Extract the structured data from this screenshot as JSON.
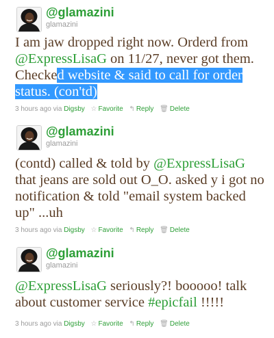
{
  "tweets": [
    {
      "screen_name": "@glamazini",
      "real_name": "glamazini",
      "text_parts": [
        {
          "t": "I am jaw dropped right now. Orderd from ",
          "type": "text"
        },
        {
          "t": "@ExpressLisaG",
          "type": "mention"
        },
        {
          "t": " on 11/27, never got them. Checke",
          "type": "text"
        },
        {
          "t": "d website & said to call for order status. (con'td)",
          "type": "highlight"
        }
      ],
      "time": "3 hours ago",
      "via_prefix": "via",
      "via": "Digsby",
      "favorite": "Favorite",
      "reply": "Reply",
      "delete": "Delete"
    },
    {
      "screen_name": "@glamazini",
      "real_name": "glamazini",
      "text_parts": [
        {
          "t": "(contd) called & told by ",
          "type": "text"
        },
        {
          "t": "@ExpressLisaG",
          "type": "mention"
        },
        {
          "t": " that jeans are sold out O_O. asked y i got no notification & told \"email system backed up\" ...uh",
          "type": "text"
        }
      ],
      "time": "3 hours ago",
      "via_prefix": "via",
      "via": "Digsby",
      "favorite": "Favorite",
      "reply": "Reply",
      "delete": "Delete"
    },
    {
      "screen_name": "@glamazini",
      "real_name": "glamazini",
      "text_parts": [
        {
          "t": "@ExpressLisaG",
          "type": "mention"
        },
        {
          "t": " seriously?! booooo! talk about customer service ",
          "type": "text"
        },
        {
          "t": "#epicfail",
          "type": "hashtag"
        },
        {
          "t": " !!!!!",
          "type": "text"
        }
      ],
      "time": "3 hours ago",
      "via_prefix": "via",
      "via": "Digsby",
      "favorite": "Favorite",
      "reply": "Reply",
      "delete": "Delete"
    }
  ],
  "icons": {
    "favorite": "star-outline-icon",
    "reply": "reply-arrow-icon",
    "delete": "trash-icon"
  },
  "colors": {
    "accent_green": "#2c9e36",
    "tweet_text": "#5a3d26",
    "meta_gray": "#9a9a9a",
    "selection_blue": "#3399ff"
  }
}
